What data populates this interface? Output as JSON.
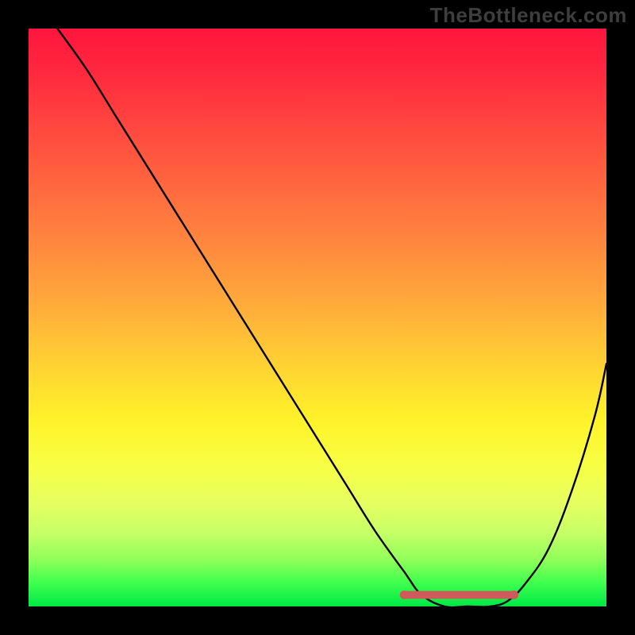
{
  "watermark": "TheBottleneck.com",
  "chart_data": {
    "type": "line",
    "title": "",
    "xlabel": "",
    "ylabel": "",
    "xlim": [
      0,
      100
    ],
    "ylim": [
      0,
      100
    ],
    "description": "Bottleneck percentage curve over a heat gradient background (red=high bottleneck, green=none). Black curve starts at top-left (~100%), descends smoothly to a flat minimum near x≈68–82 at y≈0, then rises toward the right edge. A brownish-red segment highlights the flat optimum zone at the bottom.",
    "series": [
      {
        "name": "bottleneck-curve",
        "x": [
          5,
          10,
          15,
          20,
          25,
          30,
          35,
          40,
          45,
          50,
          55,
          60,
          65,
          68,
          72,
          76,
          80,
          83,
          86,
          90,
          94,
          98,
          100
        ],
        "values": [
          100,
          93,
          85,
          77,
          69,
          61,
          53,
          45,
          37,
          29,
          21,
          13,
          6,
          2,
          0,
          0,
          0,
          1,
          4,
          10,
          20,
          33,
          42
        ]
      }
    ],
    "optimum_band": {
      "x_start": 65,
      "x_end": 84,
      "y": 2
    },
    "gradient_stops": [
      {
        "pct": 0,
        "color": "#ff153e"
      },
      {
        "pct": 50,
        "color": "#ffc637"
      },
      {
        "pct": 75,
        "color": "#fdff3a"
      },
      {
        "pct": 100,
        "color": "#00e846"
      }
    ]
  }
}
